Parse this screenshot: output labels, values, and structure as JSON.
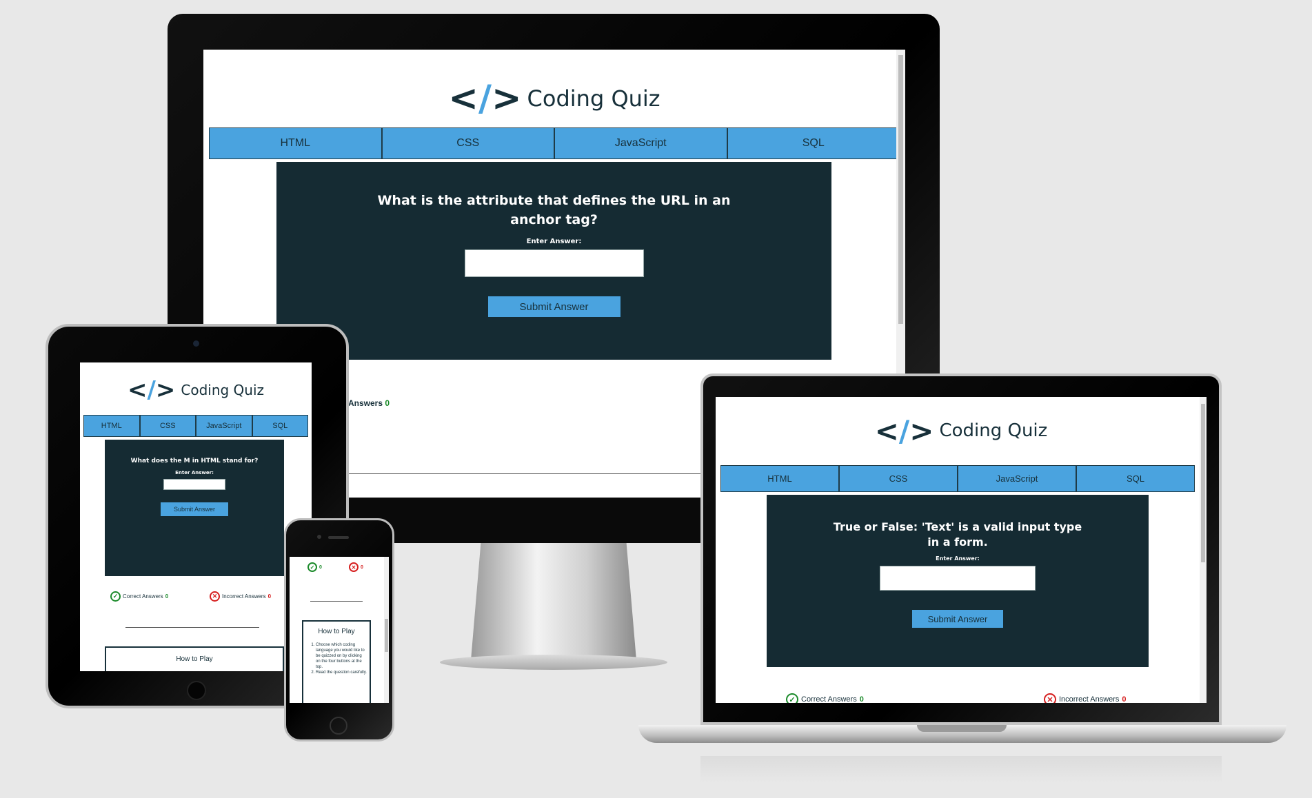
{
  "brand": {
    "title": "Coding Quiz",
    "accent": "#4aa3df",
    "dark": "#152b33"
  },
  "nav_tabs": [
    "HTML",
    "CSS",
    "JavaScript",
    "SQL"
  ],
  "desktop": {
    "question": "What is the attribute that defines the URL in an anchor tag?",
    "answer_label": "Enter Answer:",
    "submit_label": "Submit Answer",
    "score_text": "Answers",
    "score_value": "0"
  },
  "tablet": {
    "question": "What does the M in HTML stand for?",
    "answer_label": "Enter Answer:",
    "submit_label": "Submit Answer",
    "correct_label": "Correct Answers",
    "correct_value": "0",
    "incorrect_label": "Incorrect Answers",
    "incorrect_value": "0",
    "how_to_play": "How to Play"
  },
  "laptop": {
    "question": "True or False: 'Text' is a valid input type in a form.",
    "answer_label": "Enter Answer:",
    "submit_label": "Submit Answer",
    "correct_label": "Correct Answers",
    "correct_value": "0",
    "incorrect_label": "Incorrect Answers",
    "incorrect_value": "0"
  },
  "phone": {
    "correct_value": "0",
    "incorrect_value": "0",
    "how_to_play": "How to Play",
    "steps": [
      "Choose which coding language you would like to be quizzed on by clicking on the four buttons at the top.",
      "Read the question carefully."
    ]
  }
}
